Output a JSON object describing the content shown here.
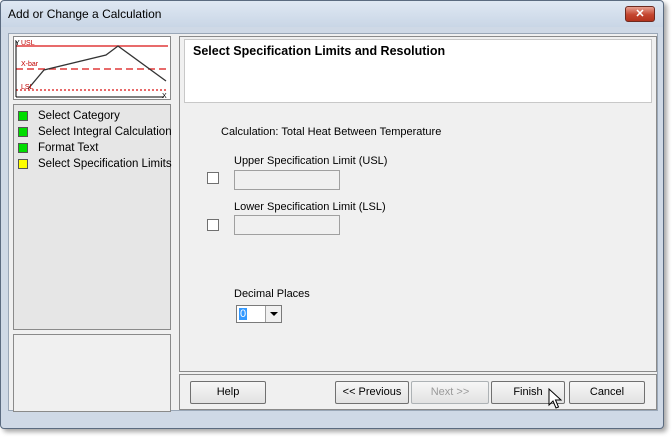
{
  "window": {
    "title": "Add or Change a Calculation",
    "close_glyph": "✕"
  },
  "thumbnail": {
    "y_label": "Y",
    "x_label": "X",
    "usl_label": "USL",
    "xbar_label": "X-bar",
    "lsl_label": "LSL",
    "line_color": "#e03a3a"
  },
  "steps": [
    {
      "label": "Select Category",
      "color": "#00dd00"
    },
    {
      "label": "Select Integral Calculation",
      "color": "#00dd00"
    },
    {
      "label": "Format Text",
      "color": "#00dd00"
    },
    {
      "label": "Select Specification Limits",
      "color": "#ffff00"
    }
  ],
  "panel": {
    "title": "Select Specification Limits and Resolution",
    "calculation_text": "Calculation: Total Heat Between Temperature",
    "usl_label": "Upper Specification Limit (USL)",
    "usl_value": "",
    "usl_checked": false,
    "lsl_label": "Lower Specification Limit (LSL)",
    "lsl_value": "",
    "lsl_checked": false,
    "decimal_label": "Decimal Places",
    "decimal_value": "0"
  },
  "buttons": {
    "help": "Help",
    "previous": "<< Previous",
    "next": "Next >>",
    "finish": "Finish",
    "cancel": "Cancel"
  }
}
